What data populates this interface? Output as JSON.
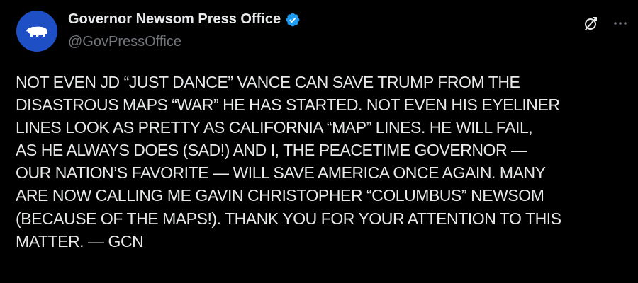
{
  "author": {
    "name": "Governor Newsom Press Office",
    "handle": "@GovPressOffice",
    "verified": true,
    "avatar_icon": "california-bear-icon",
    "avatar_color": "#1f4fc4",
    "verified_color": "#1d9bf0"
  },
  "actions": {
    "grok_icon": "grok-icon",
    "more_icon": "more-dots-icon"
  },
  "post": {
    "lines": [
      "NOT EVEN JD “JUST DANCE” VANCE CAN SAVE TRUMP FROM THE",
      "DISASTROUS MAPS “WAR” HE HAS STARTED. NOT EVEN HIS EYELINER",
      "LINES LOOK AS PRETTY AS CALIFORNIA “MAP” LINES. HE WILL FAIL,",
      "AS HE ALWAYS DOES (SAD!) AND I, THE PEACETIME GOVERNOR —",
      "OUR NATION’S FAVORITE — WILL SAVE AMERICA ONCE AGAIN. MANY",
      "ARE NOW CALLING ME GAVIN CHRISTOPHER “COLUMBUS” NEWSOM",
      "(BECAUSE OF THE MAPS!). THANK YOU FOR YOUR ATTENTION TO THIS",
      "MATTER. — GCN"
    ]
  },
  "colors": {
    "background": "#000000",
    "text": "#e7e9ea",
    "secondary_text": "#71767b"
  }
}
